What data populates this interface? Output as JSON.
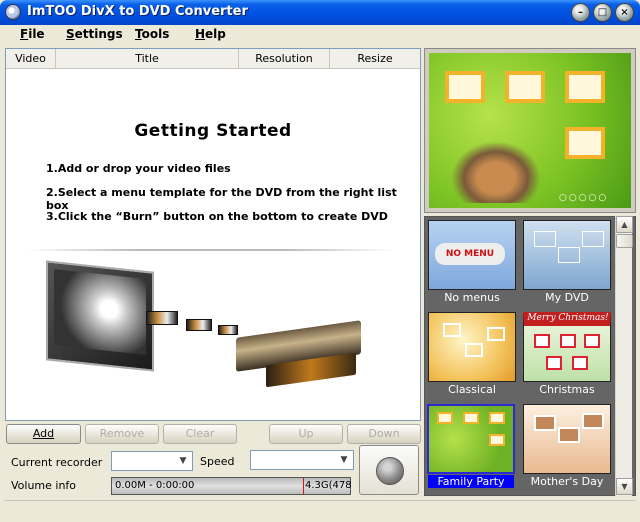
{
  "window": {
    "title": "ImTOO DivX to DVD Converter"
  },
  "menu": {
    "file": {
      "first": "F",
      "rest": "ile"
    },
    "settings": {
      "first": "S",
      "rest": "ettings"
    },
    "tools": {
      "first": "T",
      "rest": "ools"
    },
    "help": {
      "first": "H",
      "rest": "elp"
    }
  },
  "list": {
    "columns": [
      "Video",
      "Title",
      "Resolution",
      "Resize"
    ]
  },
  "getting_started": {
    "title": "Getting Started",
    "steps": [
      "1.Add or drop your video files",
      "2.Select a menu template for the DVD from the right list box",
      "3.Click the “Burn” button on the bottom to create DVD"
    ]
  },
  "buttons": {
    "add": "Add",
    "remove": "Remove",
    "clear": "Clear",
    "up": "Up",
    "down": "Down"
  },
  "controls": {
    "recorder_label": "Current recorder",
    "speed_label": "Speed",
    "volume_label": "Volume info",
    "volume_used": "0.00M - 0:00:00",
    "volume_capacity": "4.3G(478"
  },
  "templates": [
    {
      "label": "No menus",
      "badge": "NO MENU"
    },
    {
      "label": "My DVD"
    },
    {
      "label": "Classical"
    },
    {
      "label": "Christmas",
      "banner": "Merry Christmas!"
    },
    {
      "label": "Family Party",
      "selected": true
    },
    {
      "label": "Mother's Day"
    }
  ],
  "colors": {
    "titlebar": "#0050e2",
    "selection": "#0000ff",
    "preview_bg": "#7cc324",
    "frame_gold": "#f2b229"
  }
}
